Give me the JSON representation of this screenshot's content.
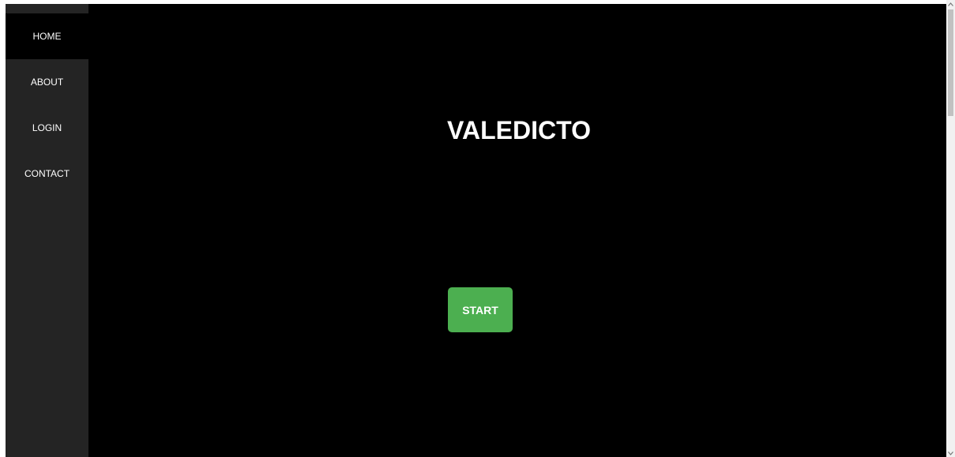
{
  "sidebar": {
    "items": [
      {
        "label": "HOME",
        "active": true
      },
      {
        "label": "ABOUT",
        "active": false
      },
      {
        "label": "LOGIN",
        "active": false
      },
      {
        "label": "CONTACT",
        "active": false
      }
    ]
  },
  "main": {
    "title": "VALEDICTO",
    "start_label": "START"
  },
  "colors": {
    "background": "#000000",
    "sidebar": "#242424",
    "accent": "#4caf50",
    "text": "#ffffff"
  },
  "icons": {
    "scroll_up": "chevron-up-icon",
    "scroll_down": "chevron-down-icon"
  }
}
